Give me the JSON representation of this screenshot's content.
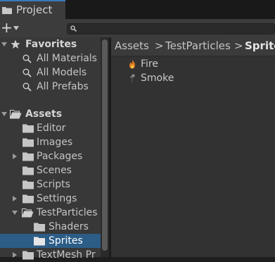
{
  "tab": {
    "label": "Project"
  },
  "toolbar": {
    "create_label": "+",
    "search_placeholder": ""
  },
  "sidebar": {
    "favorites": {
      "label": "Favorites",
      "items": [
        "All Materials",
        "All Models",
        "All Prefabs"
      ]
    },
    "assets": {
      "label": "Assets",
      "folders": [
        "Editor",
        "Images",
        "Packages",
        "Scenes",
        "Scripts",
        "Settings",
        "TestParticles",
        "TextMesh Pr"
      ],
      "testparticles_children": [
        "Shaders",
        "Sprites"
      ],
      "selected": "Sprites"
    }
  },
  "breadcrumb": [
    "Assets",
    "TestParticles",
    "Sprites"
  ],
  "files": [
    {
      "label": "Fire",
      "icon": "fire-icon"
    },
    {
      "label": "Smoke",
      "icon": "smoke-icon"
    }
  ],
  "colors": {
    "selection": "#2c5d87",
    "tab_accent": "#3a79bb"
  }
}
